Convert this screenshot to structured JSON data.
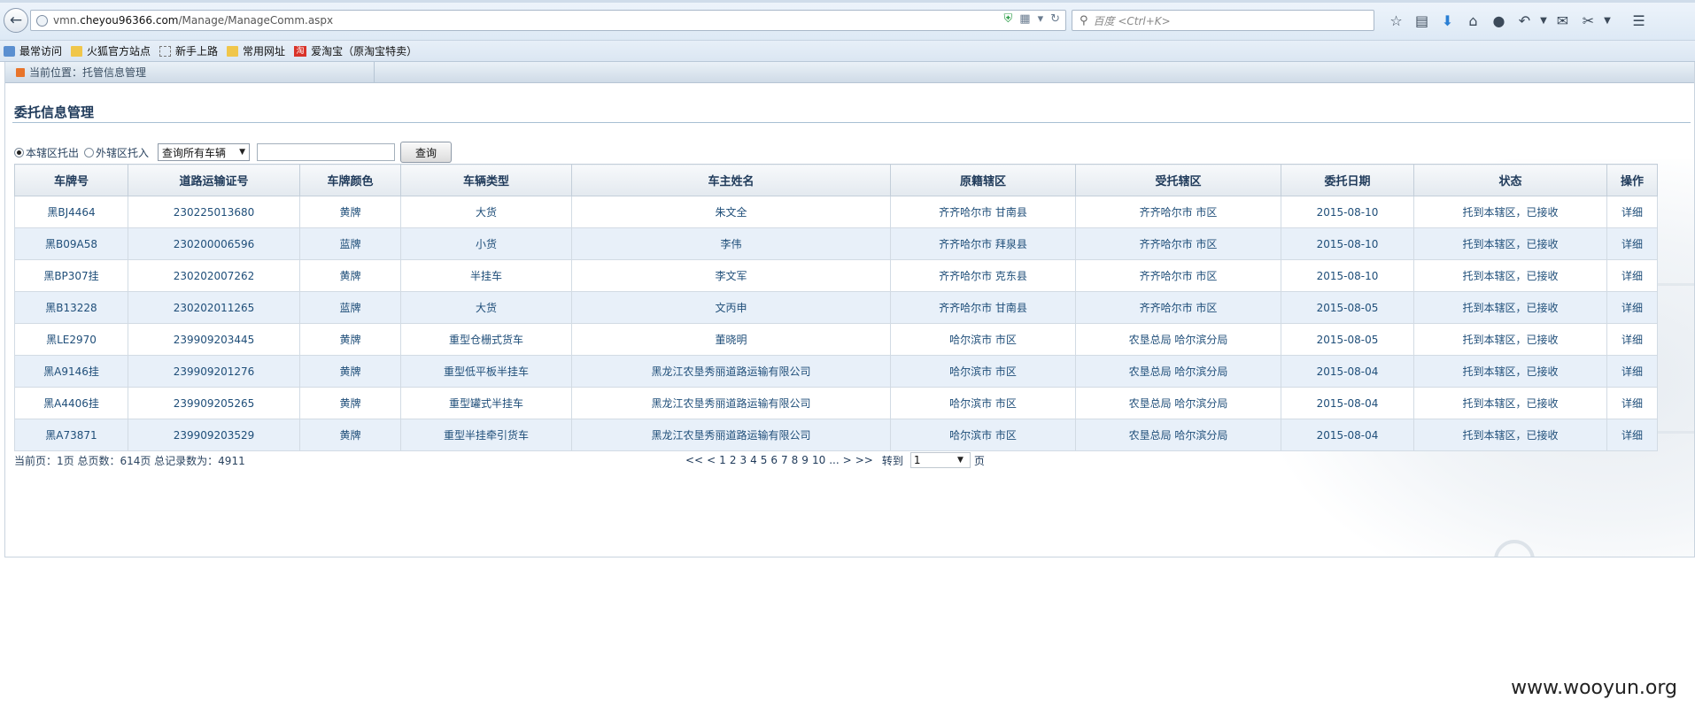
{
  "browser": {
    "url_host_prefix": "vmn.",
    "url_host": "cheyou96366.com",
    "url_path": "/Manage/ManageComm.aspx",
    "search_placeholder": "百度 <Ctrl+K>",
    "bookmarks": [
      {
        "label": "最常访问",
        "icon": "most-visited-icon"
      },
      {
        "label": "火狐官方站点",
        "icon": "folder-icon"
      },
      {
        "label": "新手上路",
        "icon": "new-page-icon"
      },
      {
        "label": "常用网址",
        "icon": "folder-icon"
      },
      {
        "label": "爱淘宝（原淘宝特卖）",
        "icon": "taobao-icon",
        "badge": "淘"
      }
    ]
  },
  "page": {
    "location": "当前位置：托管信息管理",
    "section_title": "委托信息管理",
    "filters": {
      "radio_local": "本辖区托出",
      "radio_external": "外辖区托入",
      "select_value": "查询所有车辆",
      "search_value": "",
      "query_button": "查询"
    },
    "table": {
      "headers": [
        "车牌号",
        "道路运输证号",
        "车牌颜色",
        "车辆类型",
        "车主姓名",
        "原籍辖区",
        "受托辖区",
        "委托日期",
        "状态",
        "操作"
      ],
      "rows": [
        [
          "黑BJ4464",
          "230225013680",
          "黄牌",
          "大货",
          "朱文全",
          "齐齐哈尔市  甘南县",
          "齐齐哈尔市  市区",
          "2015-08-10",
          "托到本辖区，已接收",
          "详细"
        ],
        [
          "黑B09A58",
          "230200006596",
          "蓝牌",
          "小货",
          "李伟",
          "齐齐哈尔市  拜泉县",
          "齐齐哈尔市  市区",
          "2015-08-10",
          "托到本辖区，已接收",
          "详细"
        ],
        [
          "黑BP307挂",
          "230202007262",
          "黄牌",
          "半挂车",
          "李文军",
          "齐齐哈尔市  克东县",
          "齐齐哈尔市  市区",
          "2015-08-10",
          "托到本辖区，已接收",
          "详细"
        ],
        [
          "黑B13228",
          "230202011265",
          "蓝牌",
          "大货",
          "文丙申",
          "齐齐哈尔市  甘南县",
          "齐齐哈尔市  市区",
          "2015-08-05",
          "托到本辖区，已接收",
          "详细"
        ],
        [
          "黑LE2970",
          "239909203445",
          "黄牌",
          "重型仓栅式货车",
          "董晓明",
          "哈尔滨市  市区",
          "农垦总局  哈尔滨分局",
          "2015-08-05",
          "托到本辖区，已接收",
          "详细"
        ],
        [
          "黑A9146挂",
          "239909201276",
          "黄牌",
          "重型低平板半挂车",
          "黑龙江农垦秀丽道路运输有限公司",
          "哈尔滨市  市区",
          "农垦总局  哈尔滨分局",
          "2015-08-04",
          "托到本辖区，已接收",
          "详细"
        ],
        [
          "黑A4406挂",
          "239909205265",
          "黄牌",
          "重型罐式半挂车",
          "黑龙江农垦秀丽道路运输有限公司",
          "哈尔滨市  市区",
          "农垦总局  哈尔滨分局",
          "2015-08-04",
          "托到本辖区，已接收",
          "详细"
        ],
        [
          "黑A73871",
          "239909203529",
          "黄牌",
          "重型半挂牵引货车",
          "黑龙江农垦秀丽道路运输有限公司",
          "哈尔滨市  市区",
          "农垦总局  哈尔滨分局",
          "2015-08-04",
          "托到本辖区，已接收",
          "详细"
        ]
      ]
    },
    "footer": {
      "summary": "当前页：1页 总页数：614页 总记录数为：4911",
      "pager_first": "<<",
      "pager_prev": "<",
      "pages": [
        "1",
        "2",
        "3",
        "4",
        "5",
        "6",
        "7",
        "8",
        "9",
        "10",
        "..."
      ],
      "pager_next": ">",
      "pager_last": ">>",
      "goto_label": "转到",
      "goto_value": "1",
      "goto_suffix": "页"
    }
  },
  "watermark": "www.wooyun.org"
}
